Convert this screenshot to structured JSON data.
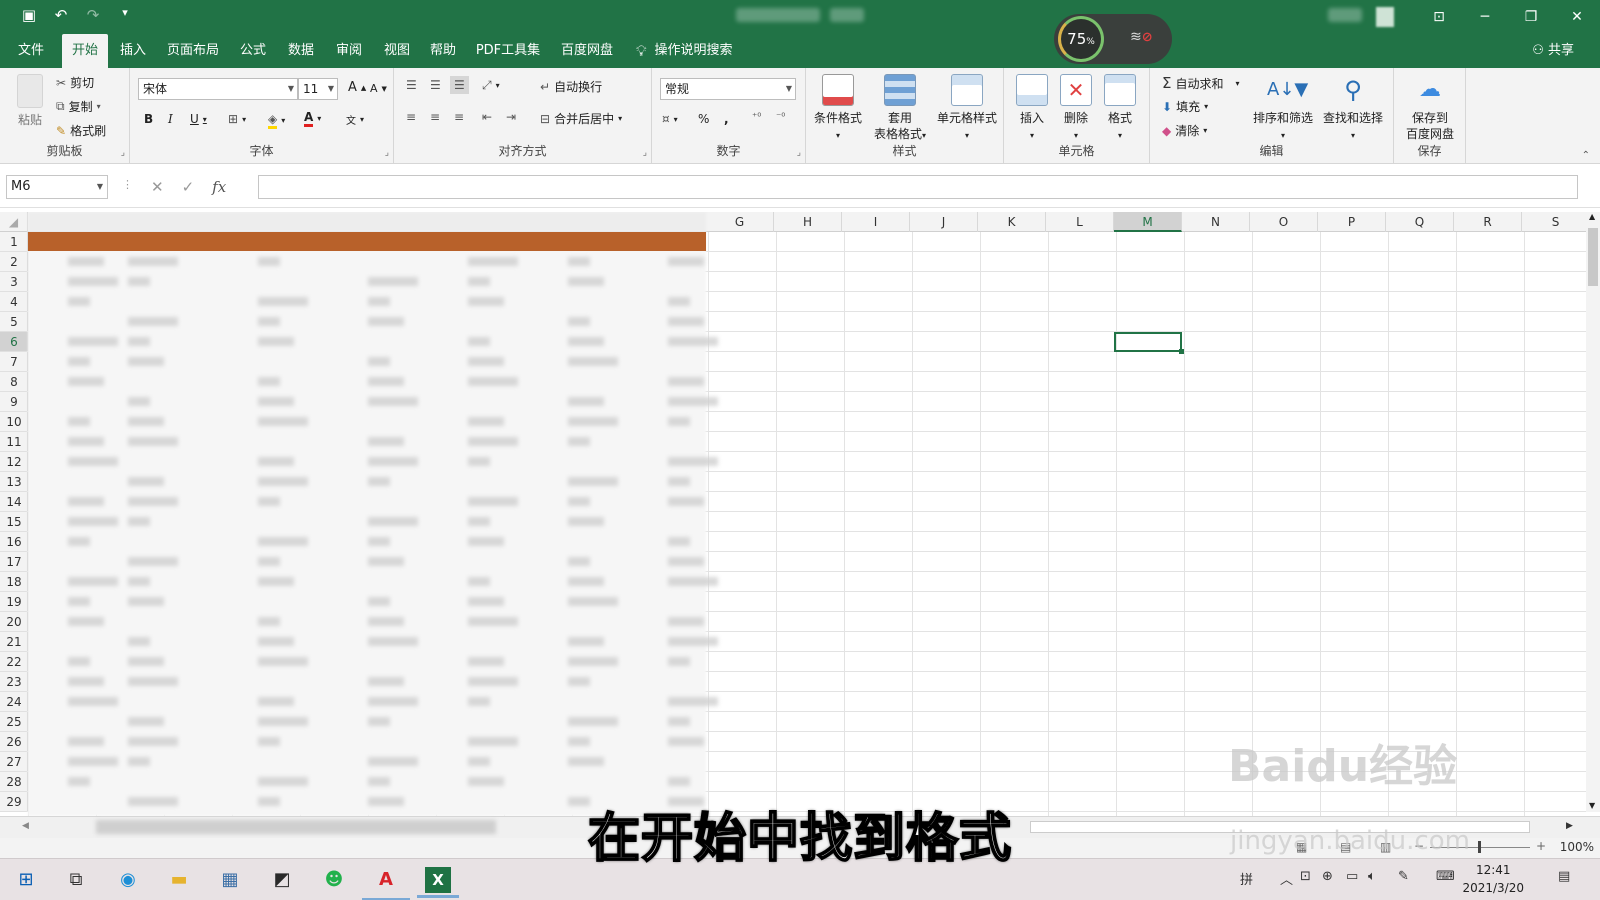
{
  "qat": {
    "save_icon": "save-icon",
    "undo_icon": "undo-icon",
    "redo_icon": "redo-icon",
    "customize": "▾"
  },
  "title_bar": {
    "restore_icon": "restore-icon"
  },
  "overlay": {
    "gauge_value": "75",
    "gauge_unit": "%",
    "network_icon": "wifi-off-icon"
  },
  "tabs": [
    "文件",
    "开始",
    "插入",
    "页面布局",
    "公式",
    "数据",
    "审阅",
    "视图",
    "帮助",
    "PDF工具集",
    "百度网盘"
  ],
  "active_tab": "开始",
  "tell_me": "操作说明搜索",
  "share": "共享",
  "ribbon": {
    "clipboard": {
      "label": "剪贴板",
      "paste": "粘贴",
      "cut": "剪切",
      "copy": "复制",
      "format_painter": "格式刷"
    },
    "font": {
      "label": "字体",
      "font_name": "宋体",
      "font_size": "11",
      "bold": "B",
      "italic": "I",
      "underline": "U",
      "grow": "A",
      "shrink": "A",
      "color_a": "A",
      "phonetic": "文"
    },
    "alignment": {
      "label": "对齐方式",
      "wrap": "自动换行",
      "merge": "合并后居中"
    },
    "number": {
      "label": "数字",
      "format": "常规",
      "percent": "%",
      "comma": ","
    },
    "styles": {
      "label": "样式",
      "conditional": "条件格式",
      "table_line1": "套用",
      "table_line2": "表格格式",
      "cell_styles": "单元格样式"
    },
    "cells": {
      "label": "单元格",
      "insert": "插入",
      "delete": "删除",
      "format": "格式"
    },
    "editing": {
      "label": "编辑",
      "autosum": "自动求和",
      "fill": "填充",
      "clear": "清除",
      "sort": "排序和筛选",
      "find": "查找和选择"
    },
    "save": {
      "label": "保存",
      "line1": "保存到",
      "line2": "百度网盘"
    }
  },
  "formula_bar": {
    "name_box": "M6",
    "fx": "fx",
    "value": ""
  },
  "columns": [
    "G",
    "H",
    "I",
    "J",
    "K",
    "L",
    "M",
    "N",
    "O",
    "P",
    "Q",
    "R",
    "S"
  ],
  "selected_column": "M",
  "rows": [
    "1",
    "2",
    "3",
    "4",
    "5",
    "6",
    "7",
    "8",
    "9",
    "10",
    "11",
    "12",
    "13",
    "14",
    "15",
    "16",
    "17",
    "18",
    "19",
    "20",
    "21",
    "22",
    "23",
    "24",
    "25",
    "26",
    "27",
    "28",
    "29"
  ],
  "selected_row": "6",
  "active_cell": "M6",
  "zoom": "100%",
  "taskbar": {
    "ime": "拼",
    "time": "12:41",
    "date": "2021/3/20"
  },
  "caption": "在开始中找到格式",
  "watermark": {
    "line1": "Baidu经验",
    "line2": "jingyan.baidu.com"
  }
}
